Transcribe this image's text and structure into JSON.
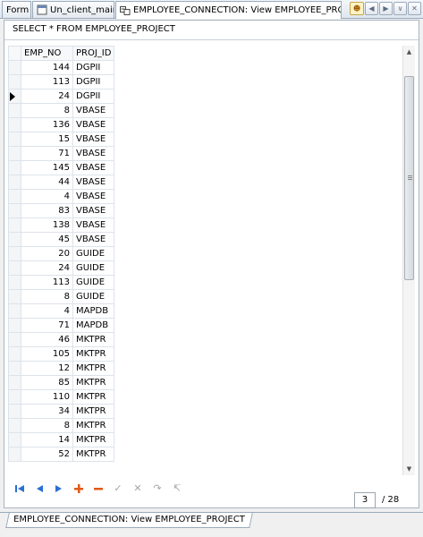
{
  "tabs": [
    {
      "label": "Form"
    },
    {
      "label": "Un_client_main"
    },
    {
      "label": "EMPLOYEE_CONNECTION: View EMPLOYEE_PROJECT"
    }
  ],
  "query": "SELECT * FROM EMPLOYEE_PROJECT",
  "grid": {
    "columns": [
      "EMP_NO",
      "PROJ_ID"
    ],
    "rows": [
      [
        "144",
        "DGPII"
      ],
      [
        "113",
        "DGPII"
      ],
      [
        "24",
        "DGPII"
      ],
      [
        "8",
        "VBASE"
      ],
      [
        "136",
        "VBASE"
      ],
      [
        "15",
        "VBASE"
      ],
      [
        "71",
        "VBASE"
      ],
      [
        "145",
        "VBASE"
      ],
      [
        "44",
        "VBASE"
      ],
      [
        "4",
        "VBASE"
      ],
      [
        "83",
        "VBASE"
      ],
      [
        "138",
        "VBASE"
      ],
      [
        "45",
        "VBASE"
      ],
      [
        "20",
        "GUIDE"
      ],
      [
        "24",
        "GUIDE"
      ],
      [
        "113",
        "GUIDE"
      ],
      [
        "8",
        "GUIDE"
      ],
      [
        "4",
        "MAPDB"
      ],
      [
        "71",
        "MAPDB"
      ],
      [
        "46",
        "MKTPR"
      ],
      [
        "105",
        "MKTPR"
      ],
      [
        "12",
        "MKTPR"
      ],
      [
        "85",
        "MKTPR"
      ],
      [
        "110",
        "MKTPR"
      ],
      [
        "34",
        "MKTPR"
      ],
      [
        "8",
        "MKTPR"
      ],
      [
        "14",
        "MKTPR"
      ],
      [
        "52",
        "MKTPR"
      ]
    ],
    "current_row_index": 2
  },
  "navigator": {
    "current_page": "3",
    "total_pages": "/ 28"
  },
  "bottom_tab": {
    "label": "EMPLOYEE_CONNECTION: View EMPLOYEE_PROJECT"
  },
  "icons": {
    "first": "first-record-icon",
    "prev": "prev-record-icon",
    "next": "next-record-icon",
    "insert": "insert-record-icon",
    "delete": "delete-record-icon",
    "post": "post-edit-icon",
    "cancel": "cancel-edit-icon",
    "refresh": "refresh-icon",
    "clear": "clear-filter-icon"
  },
  "colors": {
    "accent": "#2a6fd3",
    "insert": "#e05a1a"
  }
}
